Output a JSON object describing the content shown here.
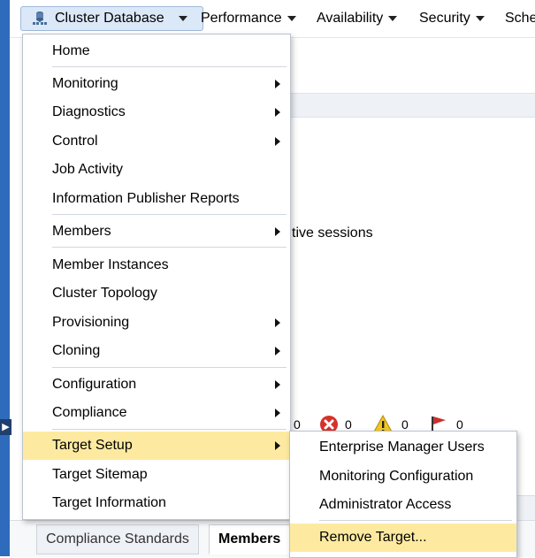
{
  "menubar": {
    "items": [
      {
        "label": "Cluster Database"
      },
      {
        "label": "Performance"
      },
      {
        "label": "Availability"
      },
      {
        "label": "Security"
      },
      {
        "label": "Sche"
      }
    ]
  },
  "background": {
    "sessions_text": "tive sessions",
    "status_counts": [
      "0",
      "0",
      "0",
      "0"
    ],
    "tabs": [
      "Compliance Standards",
      "Members"
    ]
  },
  "target_menu": {
    "items": [
      {
        "label": "Home"
      },
      {
        "label": "Monitoring"
      },
      {
        "label": "Diagnostics"
      },
      {
        "label": "Control"
      },
      {
        "label": "Job Activity"
      },
      {
        "label": "Information Publisher Reports"
      },
      {
        "label": "Members"
      },
      {
        "label": "Member Instances"
      },
      {
        "label": "Cluster Topology"
      },
      {
        "label": "Provisioning"
      },
      {
        "label": "Cloning"
      },
      {
        "label": "Configuration"
      },
      {
        "label": "Compliance"
      },
      {
        "label": "Target Setup"
      },
      {
        "label": "Target Sitemap"
      },
      {
        "label": "Target Information"
      }
    ]
  },
  "target_setup_submenu": {
    "items": [
      {
        "label": "Enterprise Manager Users"
      },
      {
        "label": "Monitoring Configuration"
      },
      {
        "label": "Administrator Access"
      },
      {
        "label": "Remove Target..."
      }
    ]
  },
  "colors": {
    "highlight": "#fdeaa0",
    "accent": "#2f6bbd",
    "active_menu_bg": "#dbe8f7"
  }
}
